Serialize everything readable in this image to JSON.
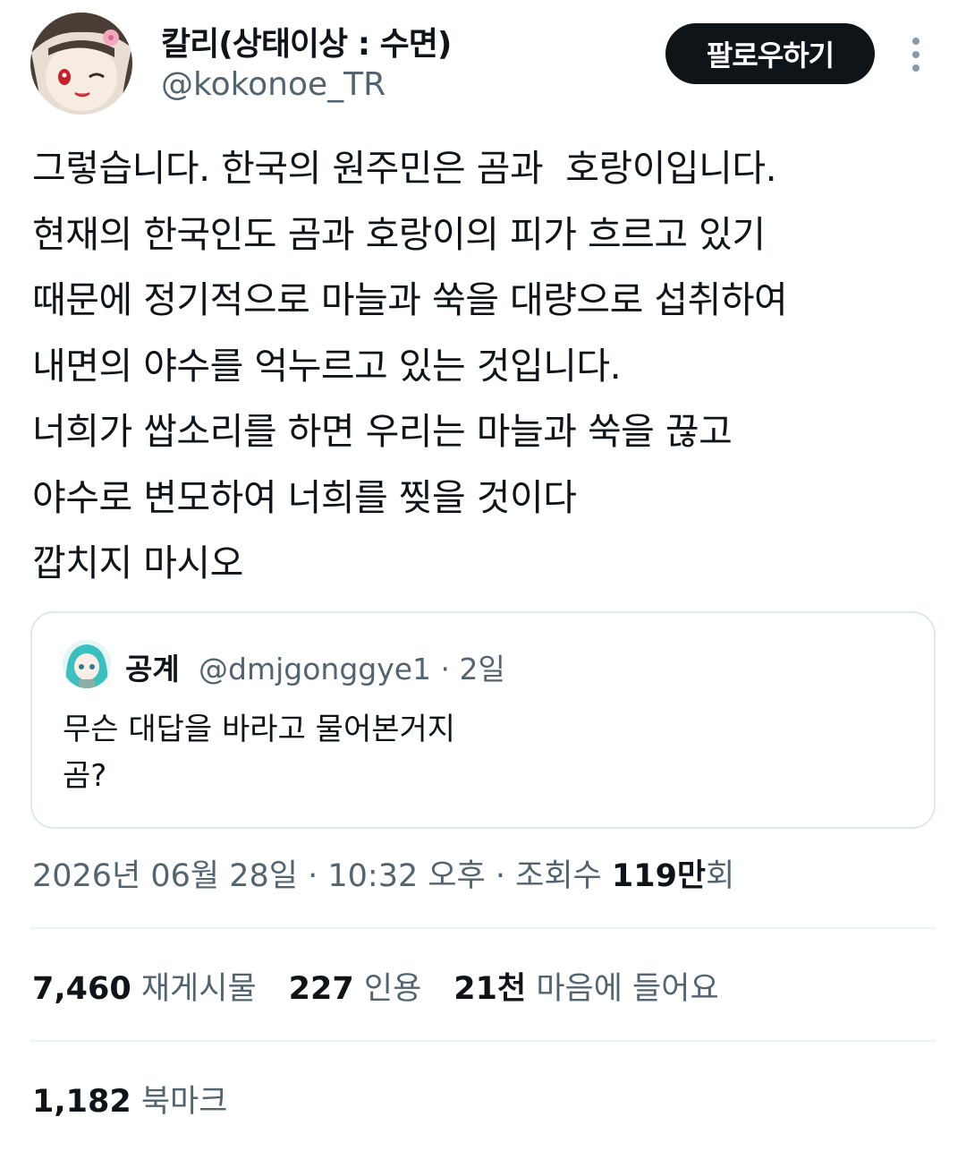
{
  "author": {
    "display_name": "칼리(상태이상 : 수면)",
    "handle": "@kokonoe_TR"
  },
  "actions": {
    "follow_label": "팔로우하기"
  },
  "tweet": {
    "text": "그렇습니다. 한국의 원주민은 곰과  호랑이입니다.\n현재의 한국인도 곰과 호랑이의 피가 흐르고 있기\n때문에 정기적으로 마늘과 쑥을 대량으로 섭취하여\n내면의 야수를 억누르고 있는 것입니다.\n너희가 쌉소리를 하면 우리는 마늘과 쑥을 끊고\n야수로 변모하여 너희를 찢을 것이다\n깝치지 마시오"
  },
  "quote": {
    "name": "공계",
    "meta": "@dmjgonggye1 · 2일",
    "text": "무슨 대답을 바라고 물어본거지\n곰?"
  },
  "timestamp": {
    "prefix": "2026년 06월 28일 · 10:32 오후 · 조회수 ",
    "views": "119만",
    "suffix": "회"
  },
  "stats": {
    "retweets_num": "7,460",
    "retweets_label": "재게시물",
    "quotes_num": "227",
    "quotes_label": "인용",
    "likes_num": "21천",
    "likes_label": "마음에 들어요",
    "bookmarks_num": "1,182",
    "bookmarks_label": "북마크"
  },
  "colors": {
    "text_primary": "#0f1419",
    "text_secondary": "#536471",
    "border": "#e1e8ed",
    "follow_bg": "#0f1419"
  },
  "icons": [
    "more-options-icon"
  ]
}
